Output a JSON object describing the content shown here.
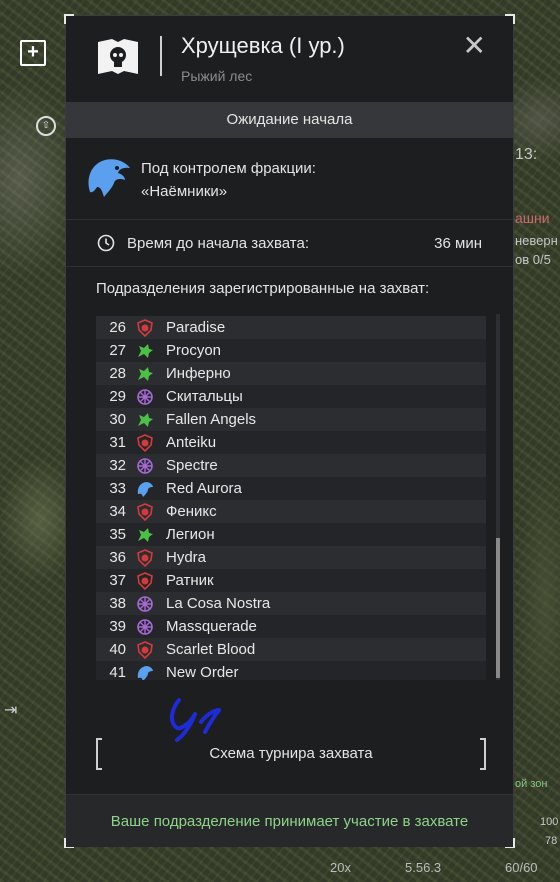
{
  "map": {
    "zoom_icon": "plus-icon",
    "compass_icon": "compass-icon",
    "right_texts": [
      "13:",
      "ашни",
      "неверн",
      "ов 0/5",
      "ой зон",
      "100",
      "78"
    ],
    "bottom_texts": [
      "20x",
      "5.56.3",
      "60/60"
    ]
  },
  "header": {
    "title": "Хрущевка (I ур.)",
    "subtitle": "Рыжий лес",
    "close_label": "✕"
  },
  "status": "Ожидание начала",
  "faction": {
    "line1": "Под контролем фракции:",
    "line2": "«Наёмники»"
  },
  "timer": {
    "label": "Время до начала захвата:",
    "value": "36 мин"
  },
  "list_title": "Подразделения зарегистрированные на захват:",
  "units": [
    {
      "num": "26",
      "name": "Paradise",
      "icon": "red-shield"
    },
    {
      "num": "27",
      "name": "Procyon",
      "icon": "green-beast"
    },
    {
      "num": "28",
      "name": "Инферно",
      "icon": "green-beast"
    },
    {
      "num": "29",
      "name": "Скитальцы",
      "icon": "purple-star"
    },
    {
      "num": "30",
      "name": "Fallen Angels",
      "icon": "green-beast"
    },
    {
      "num": "31",
      "name": "Anteiku",
      "icon": "red-shield"
    },
    {
      "num": "32",
      "name": "Spectre",
      "icon": "purple-star"
    },
    {
      "num": "33",
      "name": "Red Aurora",
      "icon": "blue-bird"
    },
    {
      "num": "34",
      "name": "Феникс",
      "icon": "red-shield"
    },
    {
      "num": "35",
      "name": "Легион",
      "icon": "green-beast"
    },
    {
      "num": "36",
      "name": "Hydra",
      "icon": "red-shield"
    },
    {
      "num": "37",
      "name": "Ратник",
      "icon": "red-shield"
    },
    {
      "num": "38",
      "name": "La Cosa Nostra",
      "icon": "purple-star"
    },
    {
      "num": "39",
      "name": "Massquerade",
      "icon": "purple-star"
    },
    {
      "num": "40",
      "name": "Scarlet Blood",
      "icon": "red-shield"
    },
    {
      "num": "41",
      "name": "New Order",
      "icon": "blue-bird"
    }
  ],
  "scheme_button": "Схема турнира захвата",
  "footer": "Ваше подразделение принимает участие в захвате",
  "colors": {
    "panel_bg": "#1d1e20",
    "status_bg": "#35373a",
    "footer_text": "#8fd48a",
    "red_icon": "#d23b3b",
    "green_icon": "#4cbf45",
    "purple_icon": "#a56ad6",
    "blue_icon": "#5aa0ee"
  }
}
